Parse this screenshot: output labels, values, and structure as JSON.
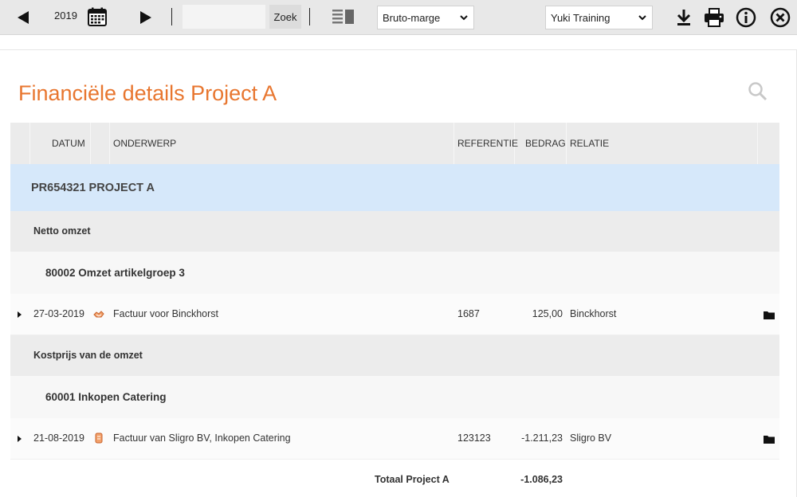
{
  "toolbar": {
    "year": "2019",
    "search_placeholder": "",
    "search_button": "Zoek",
    "view_select": "Bruto-marge",
    "admin_select": "Yuki Training"
  },
  "page": {
    "title": "Financiële details Project A"
  },
  "table": {
    "headers": {
      "datum": "DATUM",
      "onderwerp": "ONDERWERP",
      "referentie": "REFERENTIE",
      "bedrag": "BEDRAG",
      "relatie": "RELATIE"
    },
    "project": "PR654321 PROJECT A",
    "groups": [
      {
        "name": "Netto omzet",
        "subgroup": "80002 Omzet artikelgroep 3",
        "row": {
          "datum": "27-03-2019",
          "onderwerp": "Factuur voor Binckhorst",
          "referentie": "1687",
          "bedrag": "125,00",
          "relatie": "Binckhorst",
          "icon": "sales-invoice-icon"
        }
      },
      {
        "name": "Kostprijs van de omzet",
        "subgroup": "60001 Inkopen Catering",
        "row": {
          "datum": "21-08-2019",
          "onderwerp": "Factuur van Sligro BV, Inkopen Catering",
          "referentie": "123123",
          "bedrag": "-1.211,23",
          "relatie": "Sligro BV",
          "icon": "purchase-invoice-icon"
        }
      }
    ],
    "total_label": "Totaal Project A",
    "total_value": "-1.086,23"
  },
  "colors": {
    "accent": "#e8762f",
    "project_row": "#d6e8fa",
    "toolbar": "#e8e8e8"
  }
}
